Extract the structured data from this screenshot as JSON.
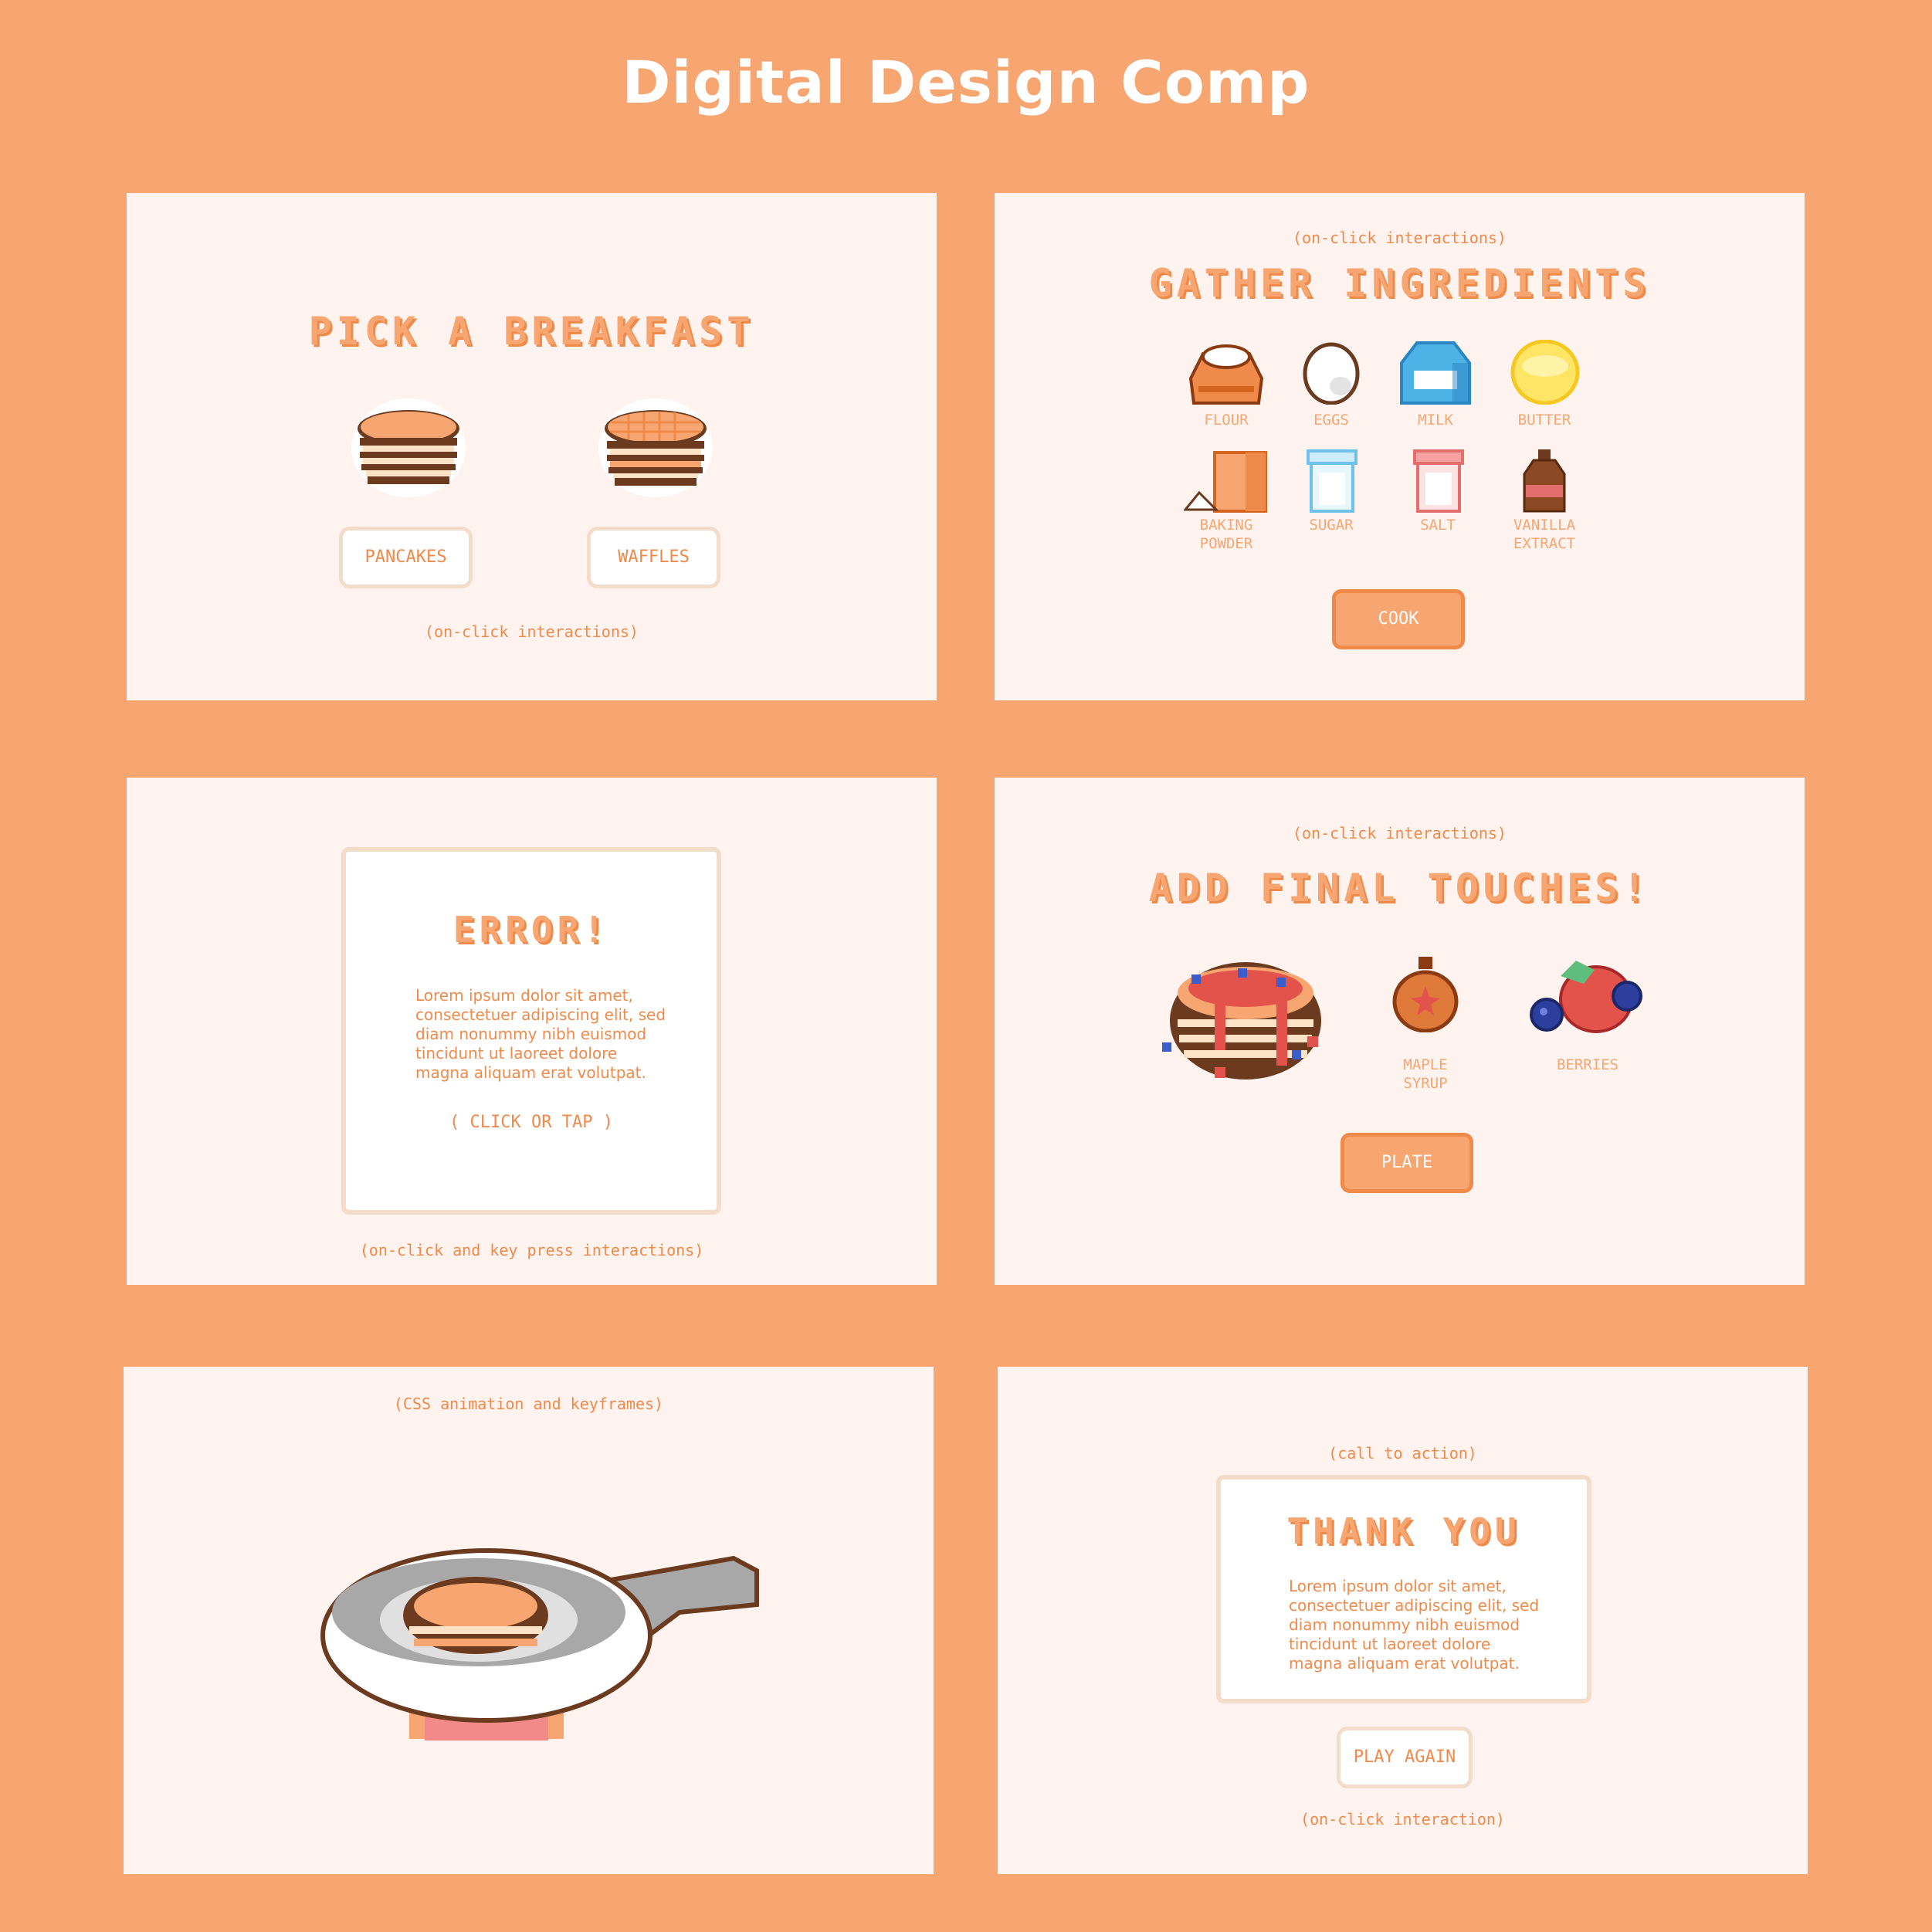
{
  "page": {
    "title": "Digital Design Comp"
  },
  "screens": {
    "pick": {
      "heading": "PICK A BREAKFAST",
      "options": [
        {
          "label": "PANCAKES"
        },
        {
          "label": "WAFFLES"
        }
      ],
      "note": "(on-click interactions)"
    },
    "gather": {
      "note": "(on-click interactions)",
      "heading": "GATHER INGREDIENTS",
      "ingredients": [
        {
          "label": "FLOUR",
          "icon": "flour-icon"
        },
        {
          "label": "EGGS",
          "icon": "egg-icon"
        },
        {
          "label": "MILK",
          "icon": "milk-icon"
        },
        {
          "label": "BUTTER",
          "icon": "butter-icon"
        },
        {
          "label_line1": "BAKING",
          "label_line2": "POWDER",
          "icon": "baking-powder-icon"
        },
        {
          "label": "SUGAR",
          "icon": "sugar-icon"
        },
        {
          "label": "SALT",
          "icon": "salt-icon"
        },
        {
          "label_line1": "VANILLA",
          "label_line2": "EXTRACT",
          "icon": "vanilla-icon"
        }
      ],
      "button": "COOK"
    },
    "error": {
      "heading": "ERROR!",
      "body": [
        "Lorem ipsum dolor sit amet,",
        "consectetuer adipiscing elit, sed",
        "diam nonummy nibh euismod",
        "tincidunt ut laoreet dolore",
        "magna aliquam erat volutpat."
      ],
      "action": "( CLICK OR TAP )",
      "note": "(on-click and key press interactions)"
    },
    "touches": {
      "note": "(on-click interactions)",
      "heading": "ADD FINAL TOUCHES!",
      "items": [
        {
          "label_line1": "MAPLE",
          "label_line2": "SYRUP",
          "icon": "syrup-icon"
        },
        {
          "label": "BERRIES",
          "icon": "berries-icon"
        }
      ],
      "button": "PLATE"
    },
    "cook": {
      "note": "(CSS animation and keyframes)"
    },
    "thanks": {
      "note_top": "(call to action)",
      "heading": "THANK YOU",
      "body": [
        "Lorem ipsum dolor sit amet,",
        "consectetuer adipiscing elit, sed",
        "diam nonummy nibh euismod",
        "tincidunt ut laoreet dolore",
        "magna aliquam erat volutpat."
      ],
      "button": "PLAY AGAIN",
      "note_bottom": "(on-click interaction)"
    }
  },
  "colors": {
    "background": "#F7A671",
    "panel": "#FEF3EE",
    "accent": "#F08A4B",
    "border_light": "#F4DCCB"
  }
}
